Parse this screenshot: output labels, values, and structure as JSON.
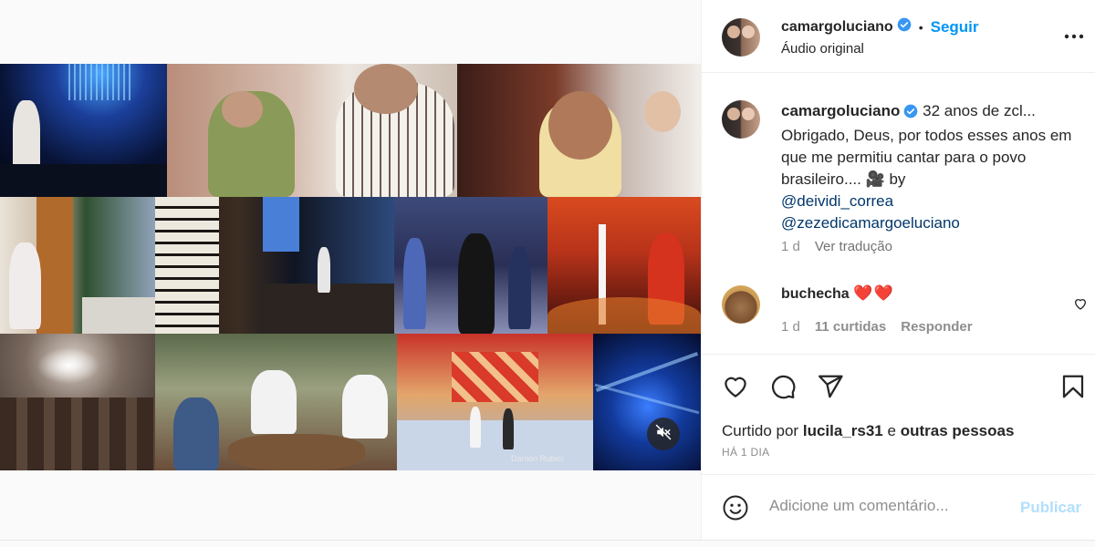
{
  "post": {
    "username": "camargoluciano",
    "follow_label": "Seguir",
    "audio_label": "Áudio original",
    "separator": "•"
  },
  "media": {
    "watermark": "Darson Rubim",
    "mute_icon": "speaker-muted-icon"
  },
  "caption": {
    "username": "camargoluciano",
    "text_line1": "32 anos de zcl...",
    "text_body": "Obrigado, Deus, por todos esses anos em que me permitiu cantar para o povo brasileiro.... 🎥 by",
    "mention1": "@deividi_correa",
    "mention2": "@zezedicamargoeluciano",
    "time": "1 d",
    "translate_label": "Ver tradução"
  },
  "comment": {
    "username": "buchecha",
    "text": "❤️❤️",
    "time": "1 d",
    "likes": "11 curtidas",
    "reply_label": "Responder"
  },
  "likes": {
    "prefix": "Curtido por",
    "user": "lucila_rs31",
    "joiner": "e",
    "others": "outras pessoas",
    "time_ago": "HÁ 1 DIA"
  },
  "comment_bar": {
    "placeholder": "Adicione um comentário...",
    "post_label": "Publicar"
  },
  "colors": {
    "accent": "#0095f6",
    "verified": "#3897f0",
    "heart": "#ed2b2b",
    "post_disabled": "#b2dffc"
  },
  "icons": [
    "verified-badge-icon",
    "more-options-icon",
    "heart-icon",
    "comment-icon",
    "share-icon",
    "bookmark-icon",
    "emoji-icon",
    "speaker-muted-icon"
  ]
}
